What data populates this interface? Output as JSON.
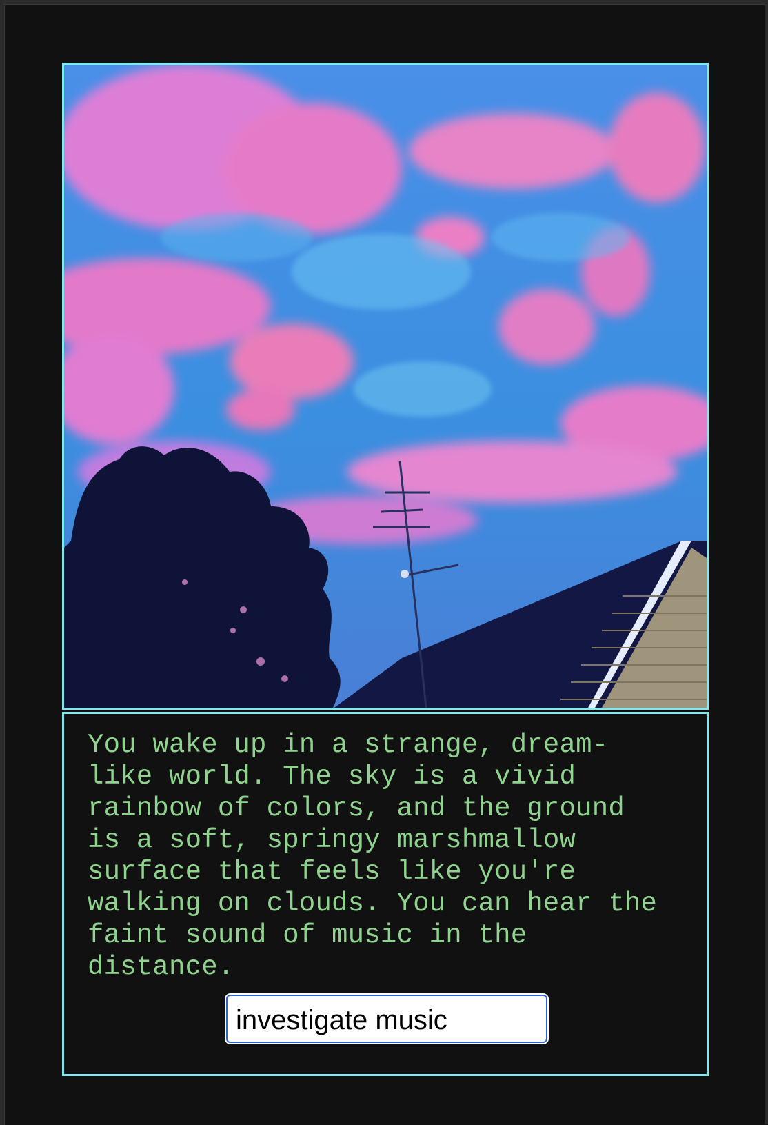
{
  "game": {
    "scene_image": {
      "subject": "dreamlike pink and blue sky with tree silhouette and rooftop",
      "colors": {
        "sky_blue": "#3d8be3",
        "cloud_pink": "#ef78c4",
        "dark_navy": "#111a45",
        "roof_edge": "#e8eefc",
        "siding": "#b7a98a"
      }
    },
    "narrative": "You wake up in a strange, dream-\nlike world. The sky is a vivid\nrainbow of colors, and the ground\nis a soft, springy marshmallow\nsurface that feels like you're\nwalking on clouds. You can hear the\nfaint sound of music in the\ndistance.",
    "command_input": {
      "value": "investigate music"
    }
  },
  "theme": {
    "frame_color": "#7fe9ee",
    "text_color": "#8fd38f",
    "background": "#111111"
  }
}
